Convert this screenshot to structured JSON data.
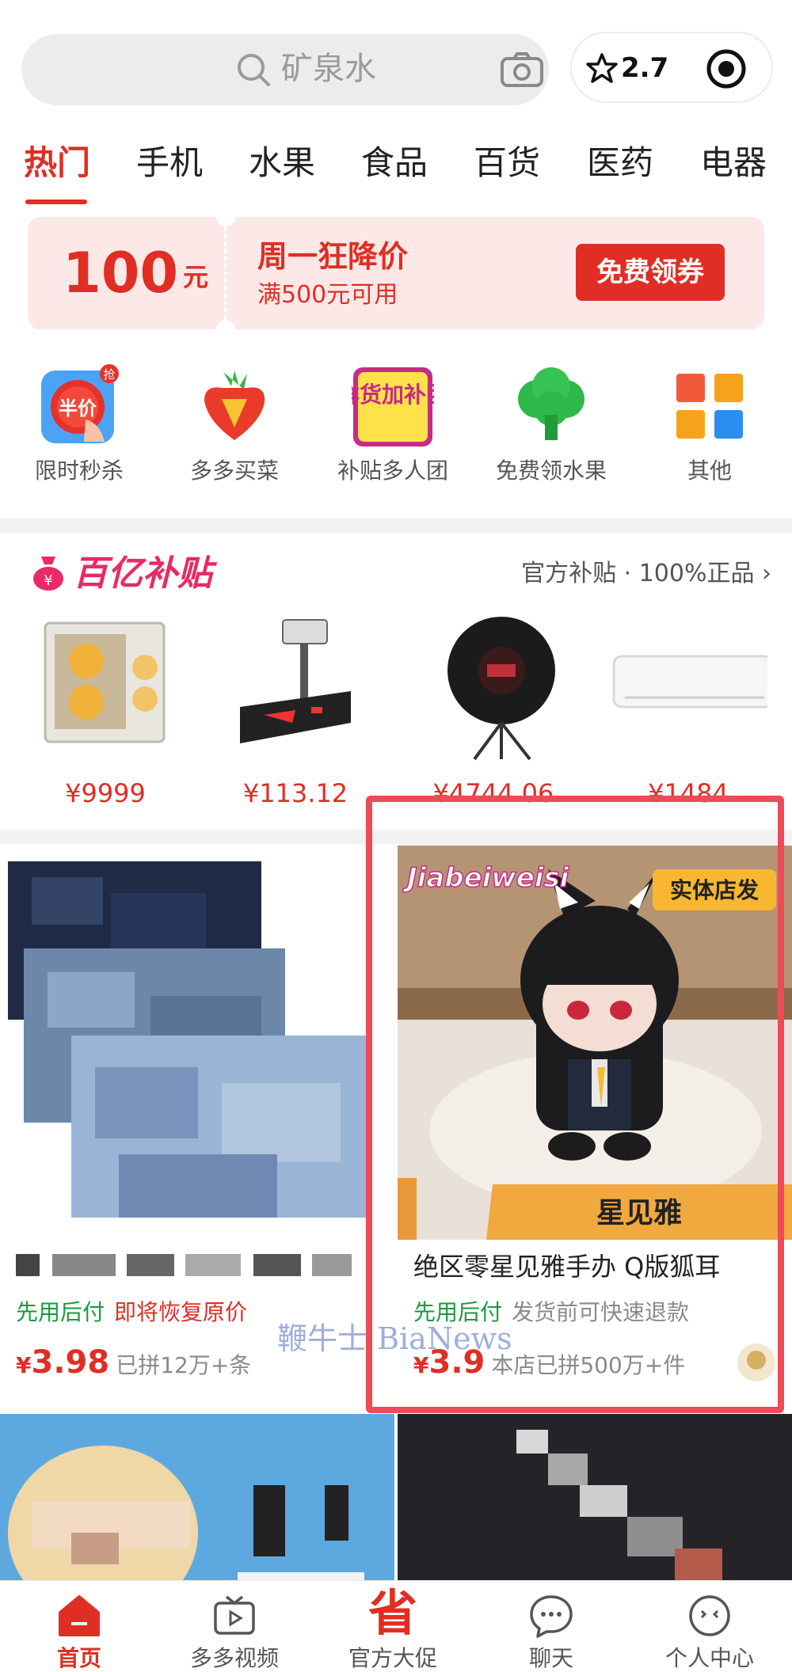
{
  "search": {
    "placeholder": "矿泉水"
  },
  "capsule": {
    "rating": "2.7"
  },
  "tabs": [
    "热门",
    "手机",
    "水果",
    "食品",
    "百货",
    "医药",
    "电器"
  ],
  "coupon": {
    "amount": "100",
    "unit": "元",
    "title": "周一狂降价",
    "subtitle": "满500元可用",
    "button": "免费领券"
  },
  "quick": [
    {
      "label": "限时秒杀",
      "icon": "flash-sale-icon",
      "badge": "抢",
      "icon_text": "半价"
    },
    {
      "label": "多多买菜",
      "icon": "carrot-icon"
    },
    {
      "label": "补贴多人团",
      "icon": "fresh-goods-icon",
      "icon_text": "鲜货加补团"
    },
    {
      "label": "免费领水果",
      "icon": "tree-icon"
    },
    {
      "label": "其他",
      "icon": "grid-icon"
    }
  ],
  "subsidy": {
    "title": "百亿补贴",
    "more": "官方补贴 · 100%正品 ›",
    "products": [
      {
        "price": "¥9999",
        "icon": "pc-case-icon"
      },
      {
        "price": "¥113.12",
        "icon": "scale-icon"
      },
      {
        "price": "¥4744.06",
        "icon": "speaker-icon"
      },
      {
        "price": "¥1484",
        "icon": "air-conditioner-icon"
      }
    ]
  },
  "feed": [
    {
      "title": "",
      "tag_green": "先用后付",
      "tag_other": "即将恢复原价",
      "yen": "¥",
      "price": "3.98",
      "sold": "已拼12万+条"
    },
    {
      "title": "绝区零星见雅手办 Q版狐耳",
      "image_brand": "Jiabeiweisi",
      "image_badge": "实体店发",
      "image_caption": "星见雅",
      "tag_green": "先用后付",
      "tag_other": "发货前可快速退款",
      "yen": "¥",
      "price": "3.9",
      "sold": "本店已拼500万+件"
    }
  ],
  "watermark": "鞭牛士 BiaNews",
  "nav": [
    {
      "label": "首页",
      "icon": "home-icon",
      "active": true
    },
    {
      "label": "多多视频",
      "icon": "tv-icon"
    },
    {
      "label": "官方大促",
      "icon": "promo-icon",
      "glyph": "省"
    },
    {
      "label": "聊天",
      "icon": "chat-icon"
    },
    {
      "label": "个人中心",
      "icon": "profile-icon"
    }
  ],
  "colors": {
    "accent": "#e02e24",
    "subsidy_pink": "#ea2a64",
    "green": "#1a9b3c",
    "highlight": "#ee4a57"
  }
}
